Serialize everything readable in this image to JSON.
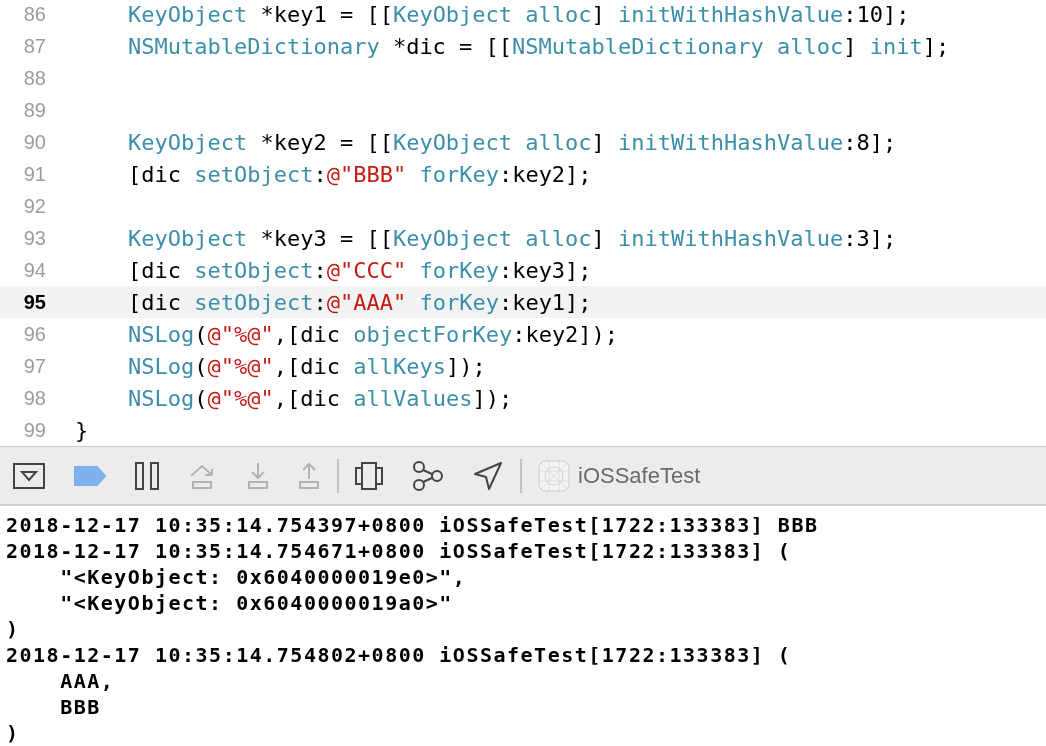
{
  "editor": {
    "lines": [
      {
        "number": "86",
        "current": false,
        "tokens": [
          {
            "kind": "class",
            "text": "    KeyObject"
          },
          {
            "kind": "plain",
            "text": " *key1 = [["
          },
          {
            "kind": "class",
            "text": "KeyObject"
          },
          {
            "kind": "method",
            "text": " alloc"
          },
          {
            "kind": "plain",
            "text": "] "
          },
          {
            "kind": "method",
            "text": "initWithHashValue"
          },
          {
            "kind": "plain",
            "text": ":10];"
          }
        ]
      },
      {
        "number": "87",
        "current": false,
        "tokens": [
          {
            "kind": "class",
            "text": "    NSMutableDictionary"
          },
          {
            "kind": "plain",
            "text": " *dic = [["
          },
          {
            "kind": "class",
            "text": "NSMutableDictionary"
          },
          {
            "kind": "method",
            "text": " alloc"
          },
          {
            "kind": "plain",
            "text": "] "
          },
          {
            "kind": "method",
            "text": "init"
          },
          {
            "kind": "plain",
            "text": "];"
          }
        ]
      },
      {
        "number": "88",
        "current": false
      },
      {
        "number": "89",
        "current": false
      },
      {
        "number": "90",
        "current": false,
        "tokens": [
          {
            "kind": "class",
            "text": "    KeyObject"
          },
          {
            "kind": "plain",
            "text": " *key2 = [["
          },
          {
            "kind": "class",
            "text": "KeyObject"
          },
          {
            "kind": "method",
            "text": " alloc"
          },
          {
            "kind": "plain",
            "text": "] "
          },
          {
            "kind": "method",
            "text": "initWithHashValue"
          },
          {
            "kind": "plain",
            "text": ":8];"
          }
        ]
      },
      {
        "number": "91",
        "current": false,
        "tokens": [
          {
            "kind": "plain",
            "text": "    [dic "
          },
          {
            "kind": "method",
            "text": "setObject"
          },
          {
            "kind": "plain",
            "text": ":"
          },
          {
            "kind": "string",
            "text": "@\"BBB\""
          },
          {
            "kind": "method",
            "text": " forKey"
          },
          {
            "kind": "plain",
            "text": ":key2];"
          }
        ]
      },
      {
        "number": "92",
        "current": false
      },
      {
        "number": "93",
        "current": false,
        "tokens": [
          {
            "kind": "class",
            "text": "    KeyObject"
          },
          {
            "kind": "plain",
            "text": " *key3 = [["
          },
          {
            "kind": "class",
            "text": "KeyObject"
          },
          {
            "kind": "method",
            "text": " alloc"
          },
          {
            "kind": "plain",
            "text": "] "
          },
          {
            "kind": "method",
            "text": "initWithHashValue"
          },
          {
            "kind": "plain",
            "text": ":3];"
          }
        ]
      },
      {
        "number": "94",
        "current": false,
        "tokens": [
          {
            "kind": "plain",
            "text": "    [dic "
          },
          {
            "kind": "method",
            "text": "setObject"
          },
          {
            "kind": "plain",
            "text": ":"
          },
          {
            "kind": "string",
            "text": "@\"CCC\""
          },
          {
            "kind": "method",
            "text": " forKey"
          },
          {
            "kind": "plain",
            "text": ":key3];"
          }
        ]
      },
      {
        "number": "95",
        "current": true,
        "tokens": [
          {
            "kind": "plain",
            "text": "    [dic "
          },
          {
            "kind": "method",
            "text": "setObject"
          },
          {
            "kind": "plain",
            "text": ":"
          },
          {
            "kind": "string",
            "text": "@\"AAA\""
          },
          {
            "kind": "method",
            "text": " forKey"
          },
          {
            "kind": "plain",
            "text": ":key1];"
          }
        ]
      },
      {
        "number": "96",
        "current": false,
        "tokens": [
          {
            "kind": "class",
            "text": "    NSLog"
          },
          {
            "kind": "plain",
            "text": "("
          },
          {
            "kind": "string",
            "text": "@\"%@\""
          },
          {
            "kind": "plain",
            "text": ",[dic "
          },
          {
            "kind": "method",
            "text": "objectForKey"
          },
          {
            "kind": "plain",
            "text": ":key2]);"
          }
        ]
      },
      {
        "number": "97",
        "current": false,
        "tokens": [
          {
            "kind": "class",
            "text": "    NSLog"
          },
          {
            "kind": "plain",
            "text": "("
          },
          {
            "kind": "string",
            "text": "@\"%@\""
          },
          {
            "kind": "plain",
            "text": ",[dic "
          },
          {
            "kind": "method",
            "text": "allKeys"
          },
          {
            "kind": "plain",
            "text": "]);"
          }
        ]
      },
      {
        "number": "98",
        "current": false,
        "tokens": [
          {
            "kind": "class",
            "text": "    NSLog"
          },
          {
            "kind": "plain",
            "text": "("
          },
          {
            "kind": "string",
            "text": "@\"%@\""
          },
          {
            "kind": "plain",
            "text": ",[dic "
          },
          {
            "kind": "method",
            "text": "allValues"
          },
          {
            "kind": "plain",
            "text": "]);"
          }
        ]
      },
      {
        "number": "99",
        "current": false,
        "tokens": [
          {
            "kind": "plain",
            "text": "}"
          }
        ]
      }
    ]
  },
  "debug_bar": {
    "buttons": [
      {
        "kind": "hide-console",
        "disabled": false
      },
      {
        "kind": "breakpoints",
        "disabled": false,
        "on": true
      },
      {
        "kind": "pause",
        "disabled": false
      },
      {
        "kind": "step-over",
        "disabled": true
      },
      {
        "kind": "step-into",
        "disabled": true
      },
      {
        "kind": "step-out",
        "disabled": true
      },
      {
        "kind": "divider"
      },
      {
        "kind": "view-debugger",
        "disabled": false
      },
      {
        "kind": "memory-graph",
        "disabled": false
      },
      {
        "kind": "location",
        "disabled": false
      },
      {
        "kind": "divider"
      }
    ],
    "target": "iOSSafeTest"
  },
  "console": {
    "lines": [
      "2018-12-17 10:35:14.754397+0800 iOSSafeTest[1722:133383] BBB",
      "2018-12-17 10:35:14.754671+0800 iOSSafeTest[1722:133383] (",
      "    \"<KeyObject: 0x6040000019e0>\",",
      "    \"<KeyObject: 0x6040000019a0>\"",
      ")",
      "2018-12-17 10:35:14.754802+0800 iOSSafeTest[1722:133383] (",
      "    AAA,",
      "    BBB",
      ")"
    ]
  }
}
